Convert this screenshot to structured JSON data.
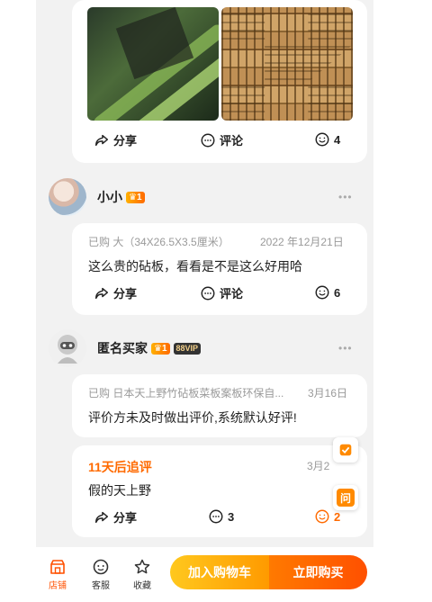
{
  "actions": {
    "share": "分享",
    "comment": "评论"
  },
  "post1": {
    "like_count": "4"
  },
  "review1": {
    "username": "小小",
    "level": "1",
    "purchase": "已购 大（34X26.5X3.5厘米）",
    "date": "2022 年12月21日",
    "content": "这么贵的砧板，看看是不是这么好用哈",
    "like_count": "6"
  },
  "review2": {
    "username": "匿名买家",
    "level": "1",
    "vip": "88VIP",
    "purchase": "已购 日本天上野竹砧板菜板案板环保自...",
    "date": "3月16日",
    "content": "评价方未及时做出评价,系统默认好评!",
    "followup_label": "11天后追评",
    "followup_date": "3月2",
    "followup_content": "假的天上野",
    "comment_count": "3",
    "like_count": "2"
  },
  "float": {
    "ask": "问"
  },
  "bottom": {
    "shop": "店铺",
    "service": "客服",
    "favorite": "收藏",
    "add_to_cart": "加入购物车",
    "buy_now": "立即购买"
  },
  "colors": {
    "accent": "#ff5000",
    "followup": "#ff6a00",
    "cart_start": "#ffc81e",
    "buy_end": "#ff5000"
  }
}
